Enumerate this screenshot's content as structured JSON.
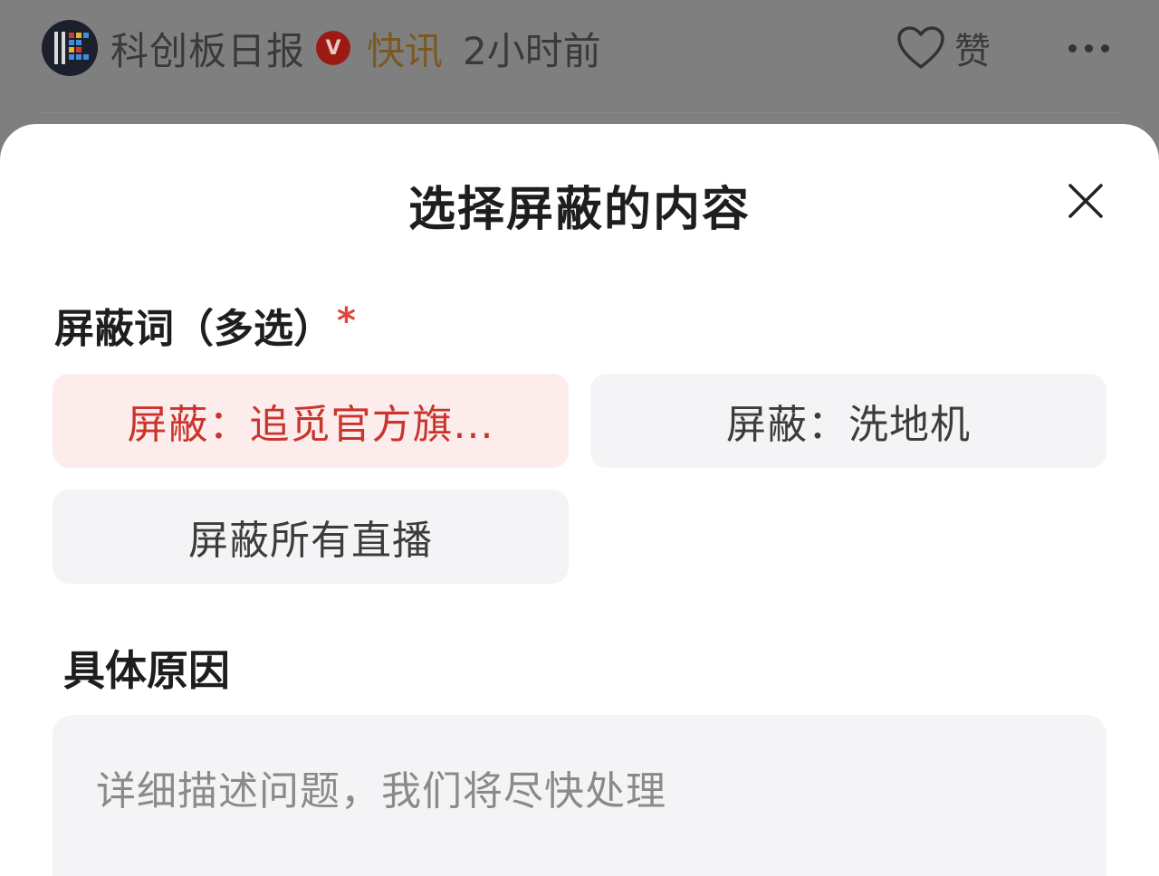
{
  "feed": {
    "author": "科创板日报",
    "verified_badge": "V",
    "tag": "快讯",
    "time_ago": "2小时前",
    "like_label": "赞",
    "icons": {
      "avatar": "brand-logo-avatar",
      "verified": "verified-badge-icon",
      "like": "heart-icon",
      "more": "more-dots-icon"
    }
  },
  "sheet": {
    "title": "选择屏蔽的内容",
    "close_icon": "close-icon",
    "keywords_label": "屏蔽词（多选）",
    "required_mark": "*",
    "options": [
      {
        "label": "屏蔽：追觅官方旗...",
        "selected": true
      },
      {
        "label": "屏蔽：洗地机",
        "selected": false
      },
      {
        "label": "屏蔽所有直播",
        "selected": false
      }
    ],
    "reason_label": "具体原因",
    "reason_placeholder": "详细描述问题，我们将尽快处理"
  },
  "colors": {
    "selected_chip_bg": "#fdecec",
    "selected_chip_text": "#c9352c",
    "chip_bg": "#f4f4f6",
    "required_mark": "#e0443a",
    "overlay": "#7f7f7f"
  }
}
